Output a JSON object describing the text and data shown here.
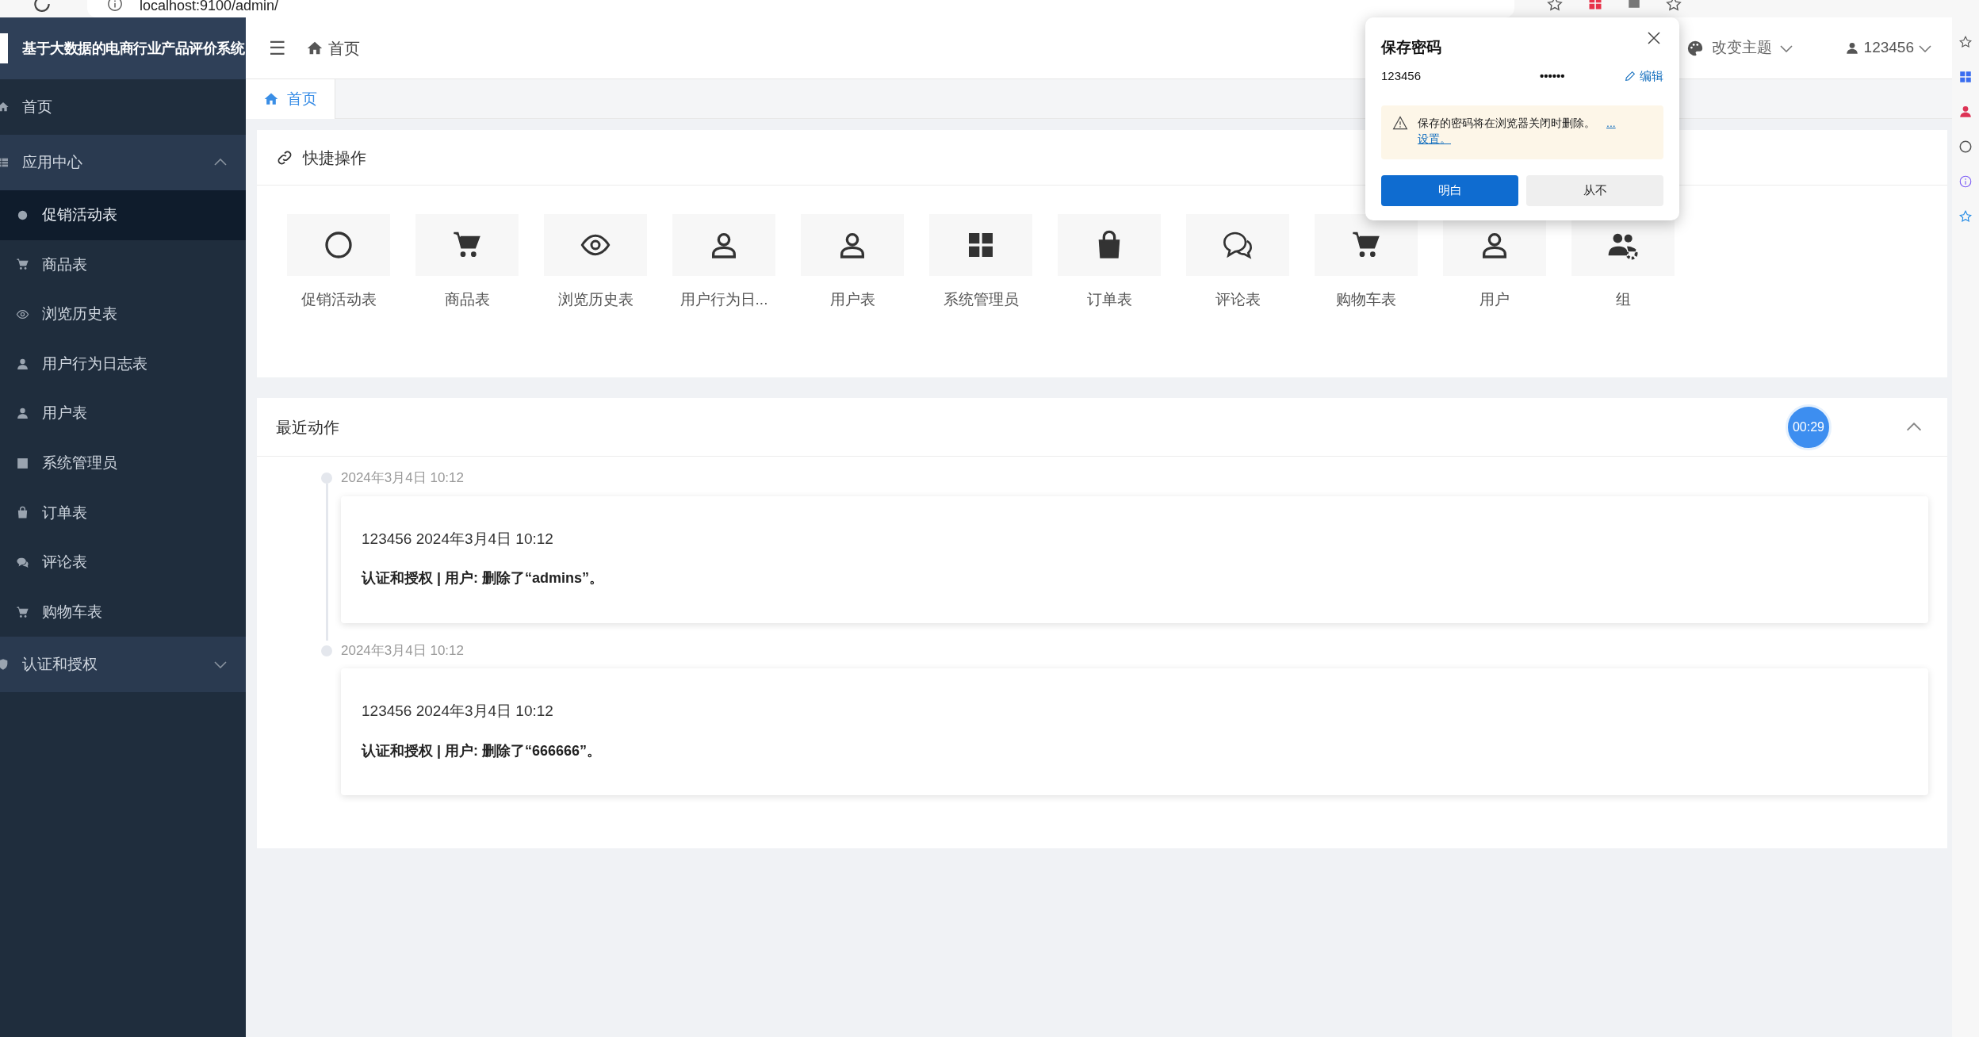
{
  "browser": {
    "url": "localhost:9100/admin/"
  },
  "sidebar": {
    "title": "基于大数据的电商行业产品评价系统",
    "items": [
      {
        "label": "首页",
        "kind": "link"
      },
      {
        "label": "应用中心",
        "kind": "group",
        "expanded": true,
        "children": [
          {
            "label": "促销活动表",
            "selected": true
          },
          {
            "label": "商品表",
            "selected": false
          },
          {
            "label": "浏览历史表",
            "selected": false
          },
          {
            "label": "用户行为日志表",
            "selected": false
          },
          {
            "label": "用户表",
            "selected": false
          },
          {
            "label": "系统管理员",
            "selected": false
          },
          {
            "label": "订单表",
            "selected": false
          },
          {
            "label": "评论表",
            "selected": false
          },
          {
            "label": "购物车表",
            "selected": false
          }
        ]
      },
      {
        "label": "认证和授权",
        "kind": "group",
        "expanded": false
      }
    ]
  },
  "header": {
    "menu_toggle": "☰",
    "breadcrumb": "首页",
    "theme": "改变主题",
    "user": "123456"
  },
  "tabs": [
    {
      "label": "首页",
      "selected": true
    }
  ],
  "quick_actions": {
    "title": "快捷操作",
    "items": [
      "促销活动表",
      "商品表",
      "浏览历史表",
      "用户行为日...",
      "用户表",
      "系统管理员",
      "订单表",
      "评论表",
      "购物车表",
      "用户",
      "组"
    ]
  },
  "recent": {
    "title": "最近动作",
    "timer": "00:29",
    "expanded": true,
    "entries": [
      {
        "time": "2024年3月4日 10:12",
        "line": "123456 2024年3月4日 10:12",
        "action": "认证和授权 | 用户: 删除了“admins”。"
      },
      {
        "time": "2024年3月4日 10:12",
        "line": "123456 2024年3月4日 10:12",
        "action": "认证和授权 | 用户: 删除了“666666”。"
      }
    ]
  },
  "password_popup": {
    "title": "保存密码",
    "username": "123456",
    "password": "••••••",
    "edit": "编辑",
    "warning": "保存的密码将在浏览器关闭时删除。",
    "more": "...",
    "settings_link": "设置。",
    "confirm": "明白",
    "never": "从不"
  }
}
